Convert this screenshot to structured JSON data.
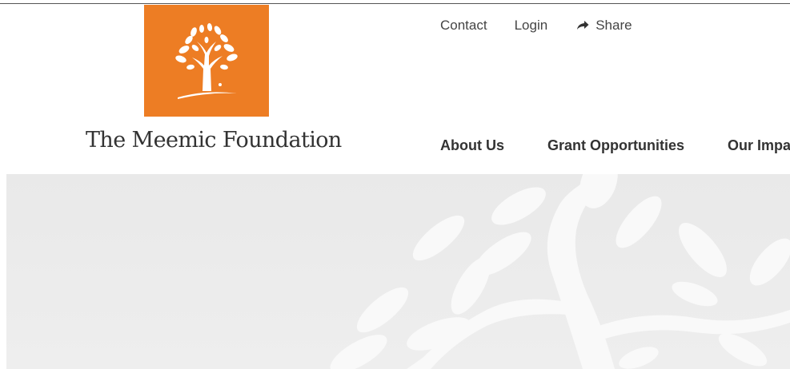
{
  "brand": {
    "name": "The Meemic Foundation",
    "logo_icon": "tree-icon",
    "logo_color": "#ed7d24"
  },
  "utility_nav": {
    "contact": "Contact",
    "login": "Login",
    "share": "Share",
    "share_icon": "share-arrow-icon"
  },
  "main_nav": {
    "items": [
      {
        "label": "About Us"
      },
      {
        "label": "Grant Opportunities"
      },
      {
        "label": "Our Impact"
      }
    ]
  },
  "hero": {
    "background_color": "#ebebeb",
    "decoration_icon": "tree-branches-icon"
  }
}
